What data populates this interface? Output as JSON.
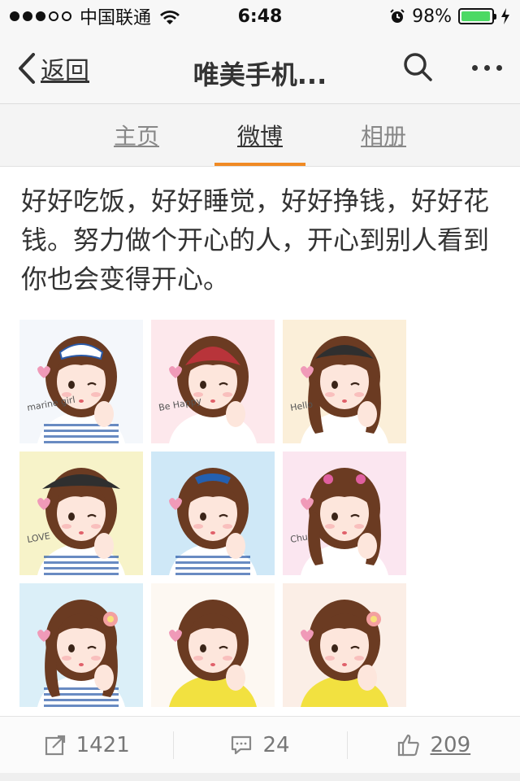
{
  "status": {
    "carrier": "中国联通",
    "time": "6:48",
    "battery": "98%",
    "battery_level": 0.98,
    "signal_bars_filled": 3,
    "signal_bars_total": 5
  },
  "nav": {
    "back_label": "返回",
    "title": "唯美手机...",
    "icons": [
      "chevron-left-icon",
      "search-icon",
      "more-icon"
    ]
  },
  "tabs": [
    {
      "label": "主页",
      "active": false
    },
    {
      "label": "微博",
      "active": true
    },
    {
      "label": "相册",
      "active": false
    }
  ],
  "post": {
    "text": "好好吃饭，好好睡觉，好好挣钱，好好花钱。努力做个开心的人，开心到别人看到你也会变得开心。",
    "images": [
      {
        "caption": "marine girl",
        "bg": "#f4f7fb",
        "accent": "#2a5aa8"
      },
      {
        "caption": "Be Happy",
        "bg": "#fde8ec",
        "accent": "#b8343a"
      },
      {
        "caption": "Hello",
        "bg": "#fbefd9",
        "accent": "#333333"
      },
      {
        "caption": "LOVE",
        "bg": "#f7f3c9",
        "accent": "#2f2f2f"
      },
      {
        "caption": "",
        "bg": "#cfe8f7",
        "accent": "#2460b0"
      },
      {
        "caption": "Chu",
        "bg": "#fbe6f0",
        "accent": "#e060a0"
      },
      {
        "caption": "",
        "bg": "#dbeff8",
        "accent": "#f3e3a6"
      },
      {
        "caption": "",
        "bg": "#fdf8f2",
        "accent": "#f2e140"
      },
      {
        "caption": "",
        "bg": "#fbeee6",
        "accent": "#f2e140"
      }
    ]
  },
  "actions": {
    "repost_count": "1421",
    "comment_count": "24",
    "like_count": "209"
  },
  "colors": {
    "accent": "#f08a24",
    "battery": "#4cd964"
  }
}
